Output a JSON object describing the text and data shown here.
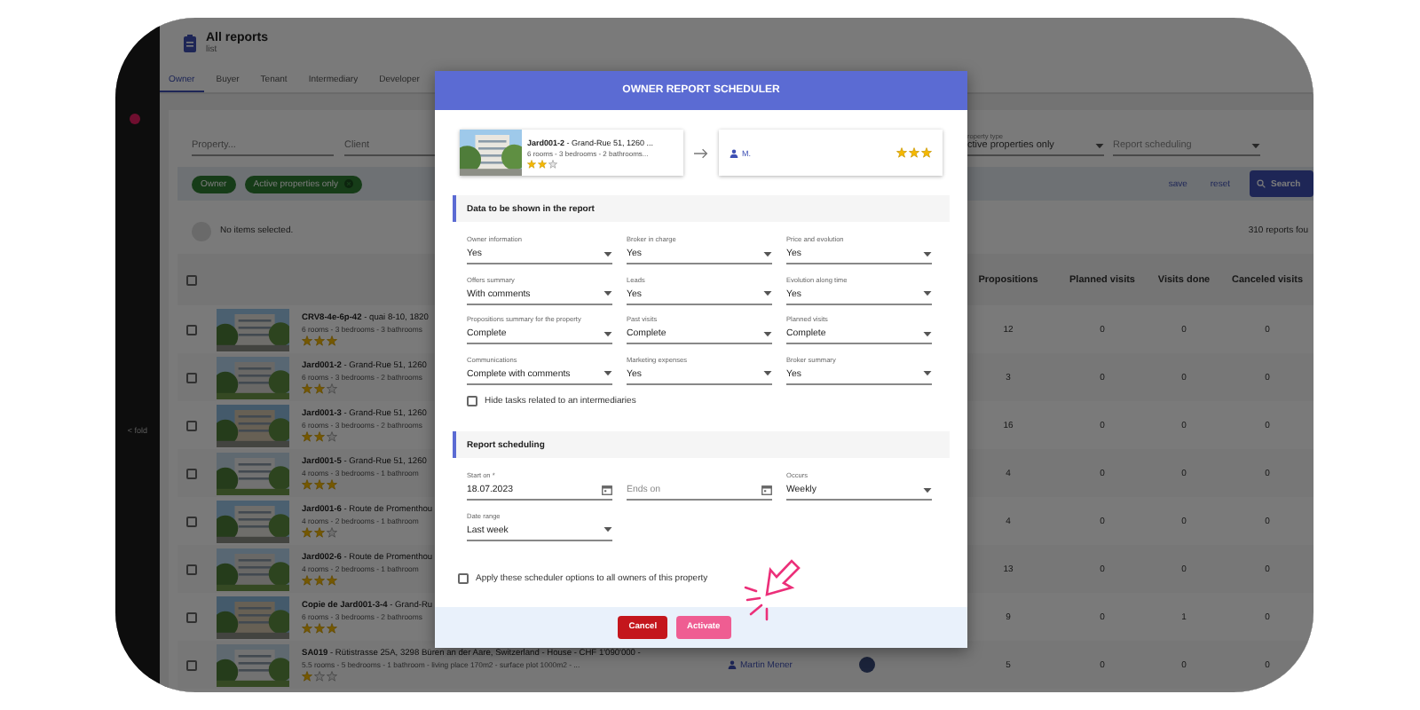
{
  "app": {
    "header": {
      "title": "All reports",
      "subtitle": "list"
    },
    "sidebar": {
      "fold_label": "< fold"
    },
    "tabs": [
      {
        "label": "Owner",
        "selected": true
      },
      {
        "label": "Buyer",
        "selected": false
      },
      {
        "label": "Tenant",
        "selected": false
      },
      {
        "label": "Intermediary",
        "selected": false
      },
      {
        "label": "Developer",
        "selected": false
      }
    ],
    "filters": {
      "property": {
        "placeholder": "Property..."
      },
      "client": {
        "placeholder": "Client"
      },
      "property_type": {
        "label": "roperty type",
        "value": "ctive properties only"
      },
      "report_scheduling": {
        "placeholder": "Report scheduling"
      }
    },
    "chips": [
      {
        "label": "Owner",
        "removable": false
      },
      {
        "label": "Active properties only",
        "removable": true
      }
    ],
    "links": [
      "save",
      "reset"
    ],
    "search_button": "Search",
    "selection_text": "No items selected.",
    "result_count": "310 reports fou",
    "table": {
      "header_checked": false,
      "columns": [
        "Propositions",
        "Planned visits",
        "Visits done",
        "Canceled visits"
      ],
      "rows": [
        {
          "title": "**CRV8-4e-6p-42** - quai 8-10, 1820",
          "details": "6 rooms - 3 bedrooms - 3 bathrooms",
          "stars": 3,
          "checked": false,
          "values": [
            "12",
            "0",
            "0",
            "0"
          ]
        },
        {
          "title": "**Jard001-2** - Grand-Rue 51, 1260",
          "details": "6 rooms - 3 bedrooms - 2 bathrooms",
          "stars": 2,
          "checked": false,
          "values": [
            "3",
            "0",
            "0",
            "0"
          ]
        },
        {
          "title": "**Jard001-3** - Grand-Rue 51, 1260",
          "details": "6 rooms - 3 bedrooms - 2 bathrooms",
          "stars": 2,
          "checked": false,
          "values": [
            "16",
            "0",
            "0",
            "0"
          ]
        },
        {
          "title": "**Jard001-5** - Grand-Rue 51, 1260",
          "details": "4 rooms - 3 bedrooms - 1 bathroom",
          "stars": 3,
          "checked": false,
          "values": [
            "4",
            "0",
            "0",
            "0"
          ]
        },
        {
          "title": "**Jard001-6** - Route de Promenthou",
          "details": "4 rooms - 2 bedrooms - 1 bathroom",
          "stars": 2,
          "checked": false,
          "values": [
            "4",
            "0",
            "0",
            "0"
          ]
        },
        {
          "title": "**Jard002-6** - Route de Promenthou",
          "details": "4 rooms - 2 bedrooms - 1 bathroom",
          "stars": 3,
          "checked": false,
          "values": [
            "13",
            "0",
            "0",
            "0"
          ]
        },
        {
          "title": "**Copie de Jard001-3-4** - Grand-Ru",
          "details": "6 rooms - 3 bedrooms - 2 bathrooms",
          "stars": 3,
          "checked": false,
          "values": [
            "9",
            "0",
            "1",
            "0"
          ]
        },
        {
          "title": "**SA019** - Rütistrasse 25A, 3298 Büren an der Aare, Switzerland - House - CHF 1'090'000 -",
          "details": "5.5 rooms - 5 bedrooms - 1 bathroom - living place 170m2 - surface plot 1000m2 - ...",
          "stars": 1,
          "checked": false,
          "owner": "Martin Mener",
          "broker_avatar": true,
          "values": [
            "5",
            "0",
            "0",
            "0"
          ]
        }
      ]
    }
  },
  "modal": {
    "title": "OWNER REPORT SCHEDULER",
    "property": {
      "title": "**Jard001-2** - Grand-Rue 51, 1260 ...",
      "details": "6 rooms - 3 bedrooms - 2 bathrooms...",
      "stars": 2
    },
    "owner": {
      "name": "M.",
      "stars": 3
    },
    "report_data": {
      "title": "Data to be shown in the report",
      "fields": [
        {
          "label": "Owner information",
          "value": "Yes"
        },
        {
          "label": "Broker in charge",
          "value": "Yes"
        },
        {
          "label": "Price and evolution",
          "value": "Yes"
        },
        {
          "label": "Offers summary",
          "value": "With comments"
        },
        {
          "label": "Leads",
          "value": "Yes"
        },
        {
          "label": "Evolution along time",
          "value": "Yes"
        },
        {
          "label": "Propositions summary for the property",
          "value": "Complete"
        },
        {
          "label": "Past visits",
          "value": "Complete"
        },
        {
          "label": "Planned visits",
          "value": "Complete"
        },
        {
          "label": "Communications",
          "value": "Complete with comments"
        },
        {
          "label": "Marketing expenses",
          "value": "Yes"
        },
        {
          "label": "Broker summary",
          "value": "Yes"
        }
      ],
      "hide_intermediaries": {
        "label": "Hide tasks related to an intermediaries",
        "checked": false
      }
    },
    "scheduling": {
      "title": "Report scheduling",
      "fields": [
        {
          "kind": "date",
          "label": "Start on *",
          "value": "18.07.2023"
        },
        {
          "kind": "date",
          "placeholder": "Ends on"
        },
        {
          "kind": "select",
          "label": "Occurs",
          "value": "Weekly"
        },
        {
          "kind": "select",
          "label": "Date range",
          "value": "Last week"
        }
      ]
    },
    "apply_all": {
      "label": "Apply these scheduler options to all owners of this property",
      "checked": false
    },
    "buttons": [
      {
        "label": "Cancel",
        "kind": "cancel"
      },
      {
        "label": "Activate",
        "kind": "primary"
      }
    ]
  }
}
